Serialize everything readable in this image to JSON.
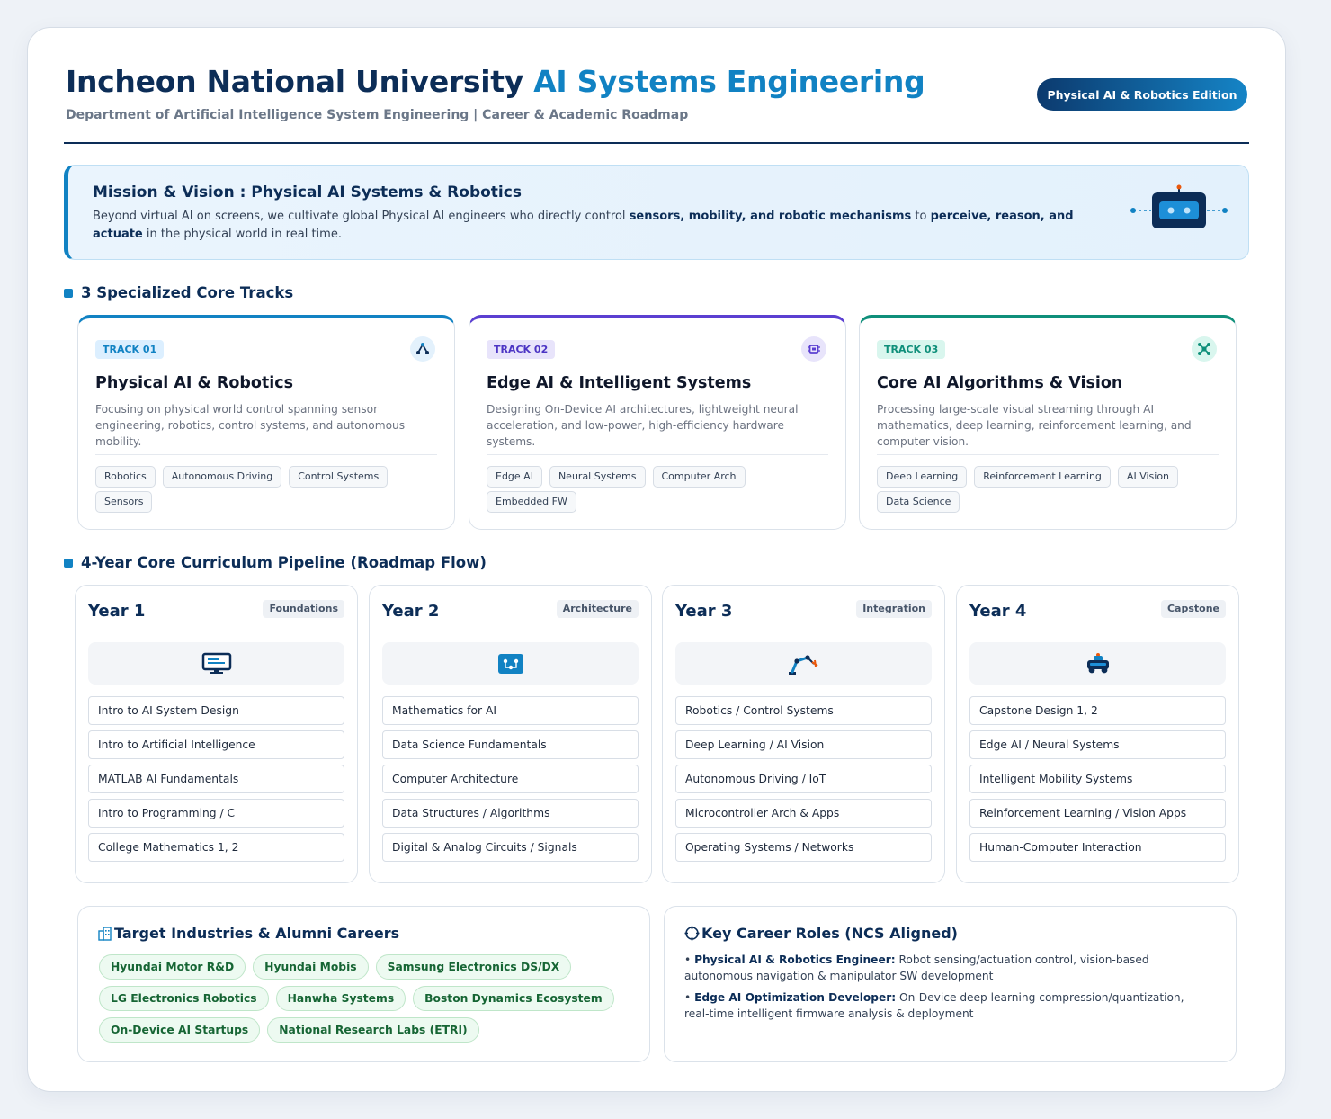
{
  "header": {
    "title_main": "Incheon National University",
    "title_accent": "AI Systems Engineering",
    "subtitle": "Department of Artificial Intelligence System Engineering | Career & Academic Roadmap",
    "edition_badge": "Physical AI & Robotics Edition"
  },
  "mission": {
    "title": "Mission & Vision : Physical AI Systems & Robotics",
    "text_1": "Beyond virtual AI on screens, we cultivate global Physical AI engineers who directly control ",
    "text_bold_1": "sensors, mobility, and robotic mechanisms",
    "text_2": " to ",
    "text_bold_2": "perceive, reason, and actuate",
    "text_3": " in the physical world in real time.",
    "icon": "robot-icon"
  },
  "tracks_section": {
    "title": "3 Specialized Core Tracks"
  },
  "tracks": [
    {
      "badge": "TRACK 01",
      "title": "Physical AI & Robotics",
      "description": "Focusing on physical world control spanning sensor engineering, robotics, control systems, and autonomous mobility.",
      "tags": [
        "Robotics",
        "Autonomous Driving",
        "Control Systems",
        "Sensors"
      ],
      "color": "#1182c3",
      "icon": "robot-arm-icon"
    },
    {
      "badge": "TRACK 02",
      "title": "Edge AI & Intelligent Systems",
      "description": "Designing On-Device AI architectures, lightweight neural acceleration, and low-power, high-efficiency hardware systems.",
      "tags": [
        "Edge AI",
        "Neural Systems",
        "Computer Arch",
        "Embedded FW"
      ],
      "color": "#5b3fd1",
      "icon": "chip-icon"
    },
    {
      "badge": "TRACK 03",
      "title": "Core AI Algorithms & Vision",
      "description": "Processing large-scale visual streaming through AI mathematics, deep learning, reinforcement learning, and computer vision.",
      "tags": [
        "Deep Learning",
        "Reinforcement Learning",
        "AI Vision",
        "Data Science"
      ],
      "color": "#0f8f7a",
      "icon": "network-icon"
    }
  ],
  "curriculum_section": {
    "title": "4-Year Core Curriculum Pipeline (Roadmap Flow)"
  },
  "years": [
    {
      "title": "Year 1",
      "tag": "Foundations",
      "icon": "monitor-icon",
      "courses": [
        "Intro to AI System Design",
        "Intro to Artificial Intelligence",
        "MATLAB AI Fundamentals",
        "Intro to Programming / C",
        "College Mathematics 1, 2"
      ]
    },
    {
      "title": "Year 2",
      "tag": "Architecture",
      "icon": "circuit-board-icon",
      "courses": [
        "Mathematics for AI",
        "Data Science Fundamentals",
        "Computer Architecture",
        "Data Structures / Algorithms",
        "Digital & Analog Circuits / Signals"
      ]
    },
    {
      "title": "Year 3",
      "tag": "Integration",
      "icon": "robot-arm-icon",
      "courses": [
        "Robotics / Control Systems",
        "Deep Learning / AI Vision",
        "Autonomous Driving / IoT",
        "Microcontroller Arch & Apps",
        "Operating Systems / Networks"
      ]
    },
    {
      "title": "Year 4",
      "tag": "Capstone",
      "icon": "autonomous-car-icon",
      "courses": [
        "Capstone Design 1, 2",
        "Edge AI / Neural Systems",
        "Intelligent Mobility Systems",
        "Reinforcement Learning / Vision Apps",
        "Human-Computer Interaction"
      ]
    }
  ],
  "industries": {
    "title": "Target Industries & Alumni Careers",
    "icon": "building-icon",
    "items": [
      "Hyundai Motor R&D",
      "Hyundai Mobis",
      "Samsung Electronics DS/DX",
      "LG Electronics Robotics",
      "Hanwha Systems",
      "Boston Dynamics Ecosystem",
      "On-Device AI Startups",
      "National Research Labs (ETRI)"
    ]
  },
  "careers": {
    "title": "Key Career Roles (NCS Aligned)",
    "icon": "target-icon",
    "roles": [
      {
        "bullet": "• ",
        "name": "Physical AI & Robotics Engineer:",
        "desc": " Robot sensing/actuation control, vision-based autonomous navigation & manipulator SW development"
      },
      {
        "bullet": "• ",
        "name": "Edge AI Optimization Developer:",
        "desc": " On-Device deep learning compression/quantization, real-time intelligent firmware analysis & deployment"
      }
    ]
  }
}
